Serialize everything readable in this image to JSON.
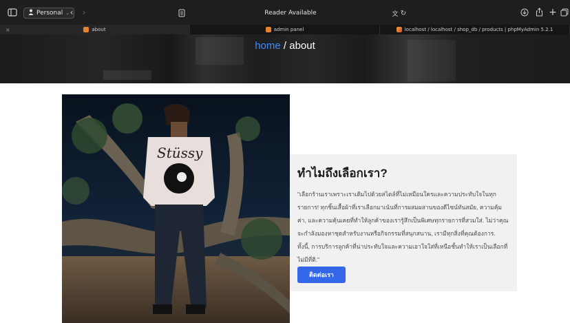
{
  "browser": {
    "profile": "Personal",
    "address_text": "Reader Available",
    "icons": [
      "sidebar-icon",
      "person-icon",
      "chevron-down-icon",
      "back-icon",
      "forward-icon",
      "reader-icon",
      "translate-icon",
      "reload-icon",
      "download-icon",
      "share-icon",
      "plus-icon",
      "tabs-overview-icon"
    ]
  },
  "tabs": [
    {
      "label": "about",
      "active": true
    },
    {
      "label": "admin panel",
      "active": false
    },
    {
      "label": "localhost / localhost / shop_db / products | phpMyAdmin 5.2.1",
      "active": false
    }
  ],
  "hero": {
    "crumb_home": "home",
    "crumb_sep": " / ",
    "crumb_current": "about"
  },
  "about": {
    "heading": "ทำไมถึงเลือกเรา?",
    "body": "\"เลือกร้านเราเพราะเราเติมไปด้วยสไตล์ที่ไม่เหมือนใครและความประทับใจในทุกรายการ! ทุกชิ้นเสื้อผ้าที่เราเลือกมาเน้นที่การผสมผสานของดีไซน์ทันสมัย, ความคุ้มค่า, และความคุ้นเคยที่ทำให้ลูกค้าของเรารู้สึกเป็นพิเศษทุกรายการที่สวมใส่. ไม่ว่าคุณจะกำลังมองหาชุดสำหรับงานหรือกิจกรรมที่สนุกสนาน, เรามีทุกสิ่งที่คุณต้องการ. ทั้งนี้, การบริการลูกค้าที่น่าประทับใจและความเอาใจใส่ที่เหนือชั้นทำให้เราเป็นเลือกที่ไม่มีที่ติ.\"",
    "button": "ติดต่อเรา"
  },
  "colors": {
    "accent": "#3466e8",
    "crumb_home": "#3d8bff",
    "card_bg": "#f1f1f1"
  }
}
